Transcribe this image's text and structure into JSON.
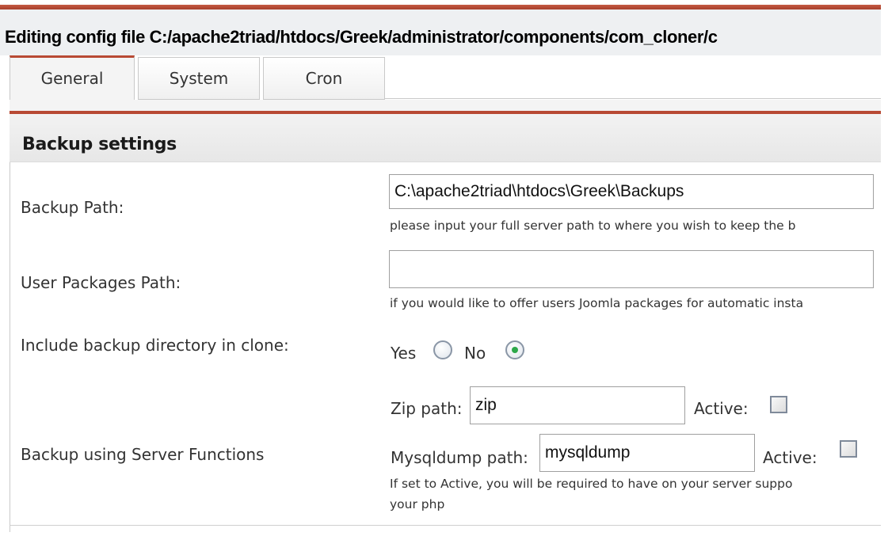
{
  "page": {
    "title": "Editing config file C:/apache2triad/htdocs/Greek/administrator/components/com_cloner/c"
  },
  "tabs": [
    {
      "label": "General",
      "active": true
    },
    {
      "label": "System",
      "active": false
    },
    {
      "label": "Cron",
      "active": false
    }
  ],
  "section": {
    "title": "Backup settings"
  },
  "backup_path": {
    "label": "Backup Path:",
    "value": "C:\\apache2triad\\htdocs\\Greek\\Backups",
    "hint": "please input your full server path to where you wish to keep the b"
  },
  "user_packages_path": {
    "label": "User Packages Path:",
    "value": "",
    "hint": "if you would like to offer users Joomla packages for automatic insta"
  },
  "include_backup_dir": {
    "label": "Include backup directory in clone:",
    "yes_label": "Yes",
    "no_label": "No",
    "selected": "No"
  },
  "server_functions": {
    "label": "Backup using Server Functions",
    "zip_label": "Zip path:",
    "zip_value": "zip",
    "zip_active_label": "Active:",
    "zip_active": false,
    "mysqldump_label": "Mysqldump path:",
    "mysqldump_value": "mysqldump",
    "mysqldump_active_label": "Active:",
    "mysqldump_active": false,
    "hint_line1": "If set to Active, you will be required to have on your server suppo",
    "hint_line2": "your php"
  },
  "colors": {
    "accent_red": "#b84a34",
    "radio_checked": "#2ea84a"
  }
}
